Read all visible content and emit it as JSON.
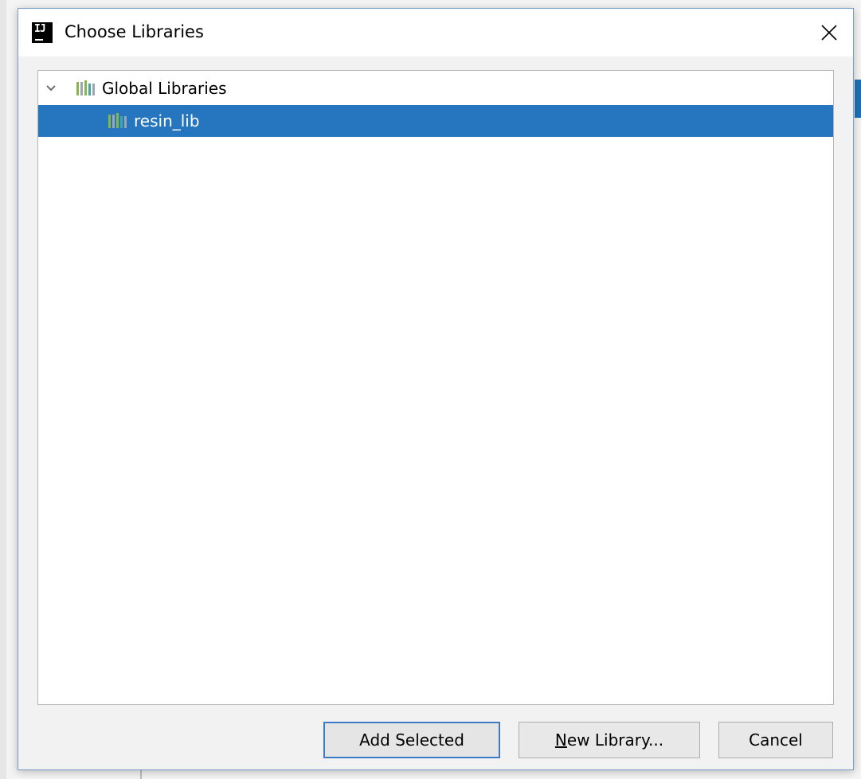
{
  "window": {
    "title": "Choose Libraries",
    "app_icon_text": "IJ"
  },
  "tree": {
    "root": {
      "label": "Global Libraries",
      "expanded": true
    },
    "children": [
      {
        "label": "resin_lib",
        "selected": true
      }
    ]
  },
  "buttons": {
    "add_selected": "Add Selected",
    "new_library_mnemonic": "N",
    "new_library_rest": "ew Library...",
    "cancel": "Cancel"
  },
  "colors": {
    "selection": "#2675bf",
    "default_button_border": "#3d7bc6",
    "library_icon_green": "#8ab547",
    "library_icon_gray": "#9aa7b0",
    "library_icon_teal": "#40a6a6"
  }
}
